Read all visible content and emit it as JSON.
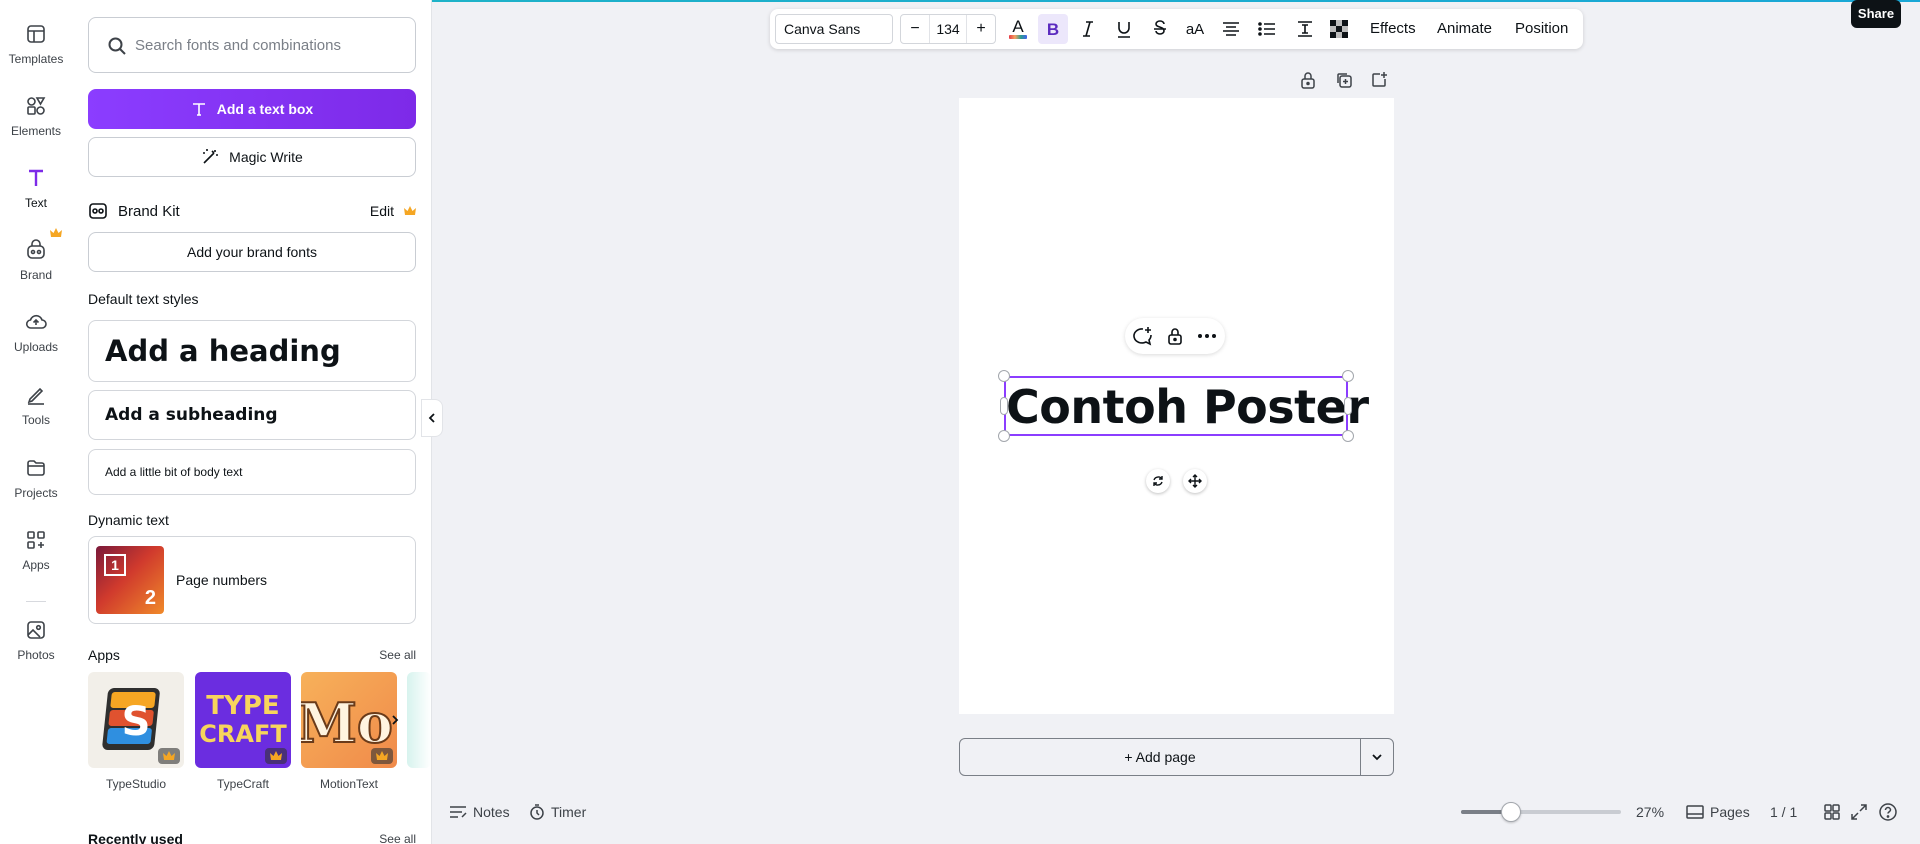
{
  "rail": {
    "items": [
      {
        "label": "Templates"
      },
      {
        "label": "Elements"
      },
      {
        "label": "Text"
      },
      {
        "label": "Brand"
      },
      {
        "label": "Uploads"
      },
      {
        "label": "Tools"
      },
      {
        "label": "Projects"
      },
      {
        "label": "Apps"
      },
      {
        "label": "Photos"
      }
    ],
    "active": "Text"
  },
  "panel": {
    "search_placeholder": "Search fonts and combinations",
    "add_textbox_label": "Add a text box",
    "magic_write_label": "Magic Write",
    "brand_kit_title": "Brand Kit",
    "brand_kit_edit": "Edit",
    "add_brand_fonts": "Add your brand fonts",
    "default_styles_title": "Default text styles",
    "heading": "Add a heading",
    "subheading": "Add a subheading",
    "body": "Add a little bit of body text",
    "dynamic_title": "Dynamic text",
    "page_numbers": "Page numbers",
    "page_numbers_thumb": {
      "one": "1",
      "two": "2"
    },
    "apps_title": "Apps",
    "apps_see_all": "See all",
    "apps": [
      {
        "name": "TypeStudio",
        "glyph": "S"
      },
      {
        "name": "TypeCraft",
        "glyph": "TYPE CRAFT"
      },
      {
        "name": "MotionText",
        "glyph": "Mo"
      }
    ],
    "recently_title": "Recently used",
    "recently_see_all": "See all"
  },
  "toolbar": {
    "font": "Canva Sans",
    "size": "134",
    "minus": "−",
    "plus": "+",
    "effects": "Effects",
    "animate": "Animate",
    "position": "Position",
    "text_color": "#0d1216"
  },
  "share_label": "Share",
  "canvas": {
    "text": "Contoh Poster"
  },
  "add_page_label": "+ Add page",
  "bottom": {
    "notes": "Notes",
    "timer": "Timer",
    "zoom": "27%",
    "zoom_level": 0.27,
    "pages_label": "Pages",
    "page_count": "1 / 1"
  },
  "colors": {
    "accent": "#8b3dff",
    "canvas_bg": "#f0f1f5"
  }
}
